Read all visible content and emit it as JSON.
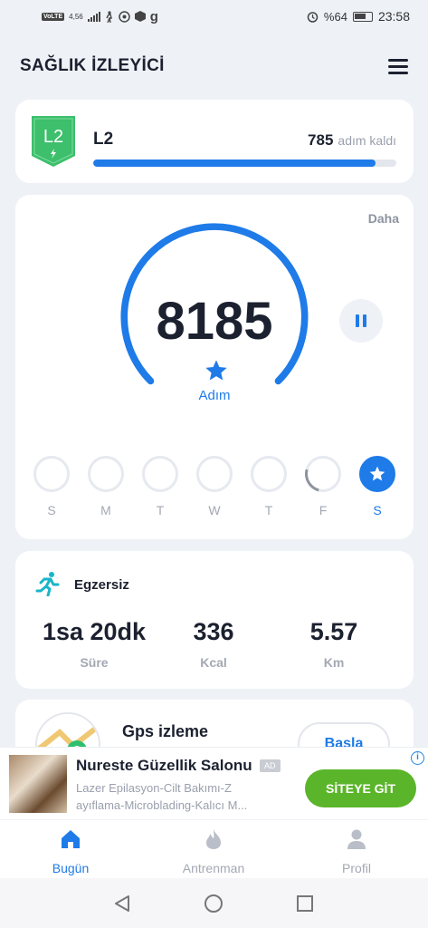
{
  "status_bar": {
    "network": "VoLTE",
    "speed": "4,56",
    "battery": "%64",
    "time": "23:58"
  },
  "header": {
    "title": "SAĞLIK İZLEYİCİ"
  },
  "level": {
    "badge": "L2",
    "name": "L2",
    "steps_left": "785",
    "steps_left_label": "adım kaldı",
    "progress": 0.93
  },
  "steps": {
    "more_label": "Daha",
    "count": "8185",
    "label": "Adım"
  },
  "week": [
    {
      "label": "S",
      "state": "empty"
    },
    {
      "label": "M",
      "state": "empty"
    },
    {
      "label": "T",
      "state": "empty"
    },
    {
      "label": "W",
      "state": "empty"
    },
    {
      "label": "T",
      "state": "empty"
    },
    {
      "label": "F",
      "state": "partial"
    },
    {
      "label": "S",
      "state": "active"
    }
  ],
  "exercise": {
    "title": "Egzersiz",
    "stats": [
      {
        "value": "1sa 20dk",
        "label": "Süre"
      },
      {
        "value": "336",
        "label": "Kcal"
      },
      {
        "value": "5.57",
        "label": "Km"
      }
    ]
  },
  "gps": {
    "title": "Gps izleme",
    "start_label": "Basla"
  },
  "ad": {
    "title": "Nureste Güzellik Salonu",
    "tag": "AD",
    "line1": "Lazer Epilasyon-Cilt Bakımı-Z",
    "line2": "ayıflama-Microblading-Kalıcı M...",
    "cta": "SİTEYE GİT"
  },
  "bottom_nav": {
    "today": "Bugün",
    "training": "Antrenman",
    "profile": "Profil"
  },
  "colors": {
    "accent": "#1e7be8",
    "ad_cta": "#5bb52a",
    "badge": "#3dbf6c"
  }
}
